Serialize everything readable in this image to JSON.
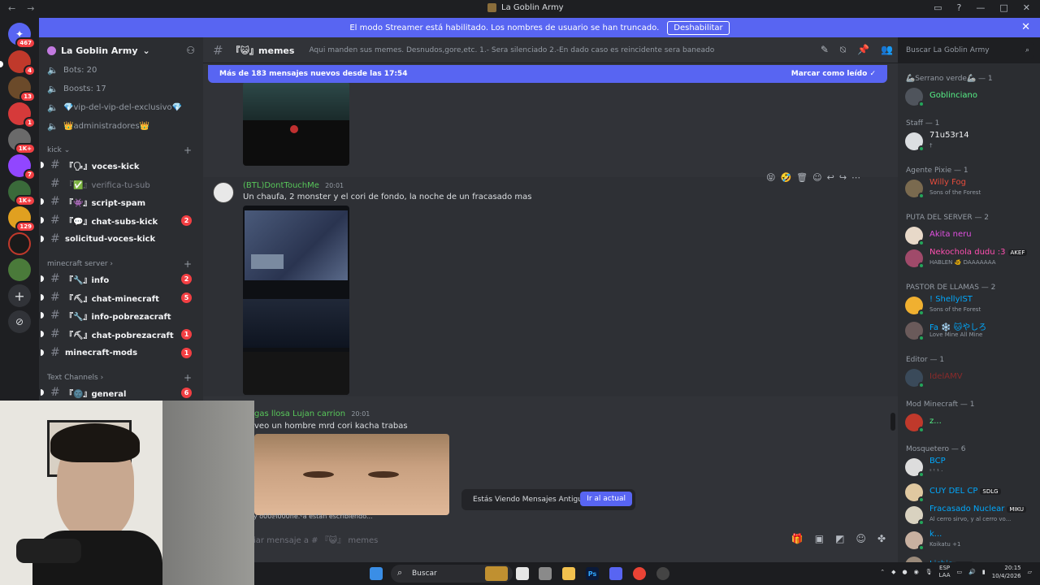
{
  "titlebar": {
    "title": "La Goblin Army"
  },
  "banner": {
    "text": "El modo Streamer está habilitado. Los nombres de usuario se han truncado.",
    "button": "Deshabilitar"
  },
  "guilds": {
    "badges": [
      "467",
      "4",
      "13",
      "1",
      "1K+",
      "7",
      "1K+",
      "129"
    ]
  },
  "server": {
    "name": "La Goblin Army"
  },
  "sidebar": {
    "top_items": [
      "Bots: 20",
      "Boosts: 17",
      "💎vip-del-vip-del-exclusivo💎",
      "👑administradores👑"
    ],
    "cat_kick": "kick",
    "kick_channels": [
      {
        "label": "『🗣』voces-kick",
        "badge": ""
      },
      {
        "label": "『✅』verifica-tu-sub",
        "badge": ""
      },
      {
        "label": "『👾』script-spam",
        "badge": ""
      },
      {
        "label": "『💬』chat-subs-kick",
        "badge": "2"
      },
      {
        "label": "solicitud-voces-kick",
        "badge": ""
      }
    ],
    "cat_mc": "minecraft server",
    "mc_channels": [
      {
        "label": "『🔧』info",
        "badge": "2"
      },
      {
        "label": "『⛏』chat-minecraft",
        "badge": "5"
      },
      {
        "label": "『🔧』info-pobrezacraft",
        "badge": ""
      },
      {
        "label": "『⛏』chat-pobrezacraft",
        "badge": "1"
      },
      {
        "label": "minecraft-mods",
        "badge": "1"
      }
    ],
    "cat_text": "Text Channels",
    "text_channels": [
      {
        "label": "『🌚』general",
        "badge": "6"
      }
    ]
  },
  "channel": {
    "name": "『😺』memes",
    "topic": "Aqui manden sus memes. Desnudos,gore,etc. 1.- Sera silenciado 2.-En dado caso es reincidente sera baneado"
  },
  "search": {
    "placeholder": "Buscar La Goblin Army"
  },
  "chat": {
    "new_messages": "Más de 183 mensajes nuevos desde las 17:54",
    "mark_read": "Marcar como leído",
    "messages": [
      {
        "author": "(BTL)DontTouchMe",
        "time": "20:01",
        "text": "Un chaufa, 2 monster y el cori de fondo, la noche de un fracasado mas"
      },
      {
        "author": "gas llosa Lujan carrion",
        "time": "20:01",
        "text": "veo un hombre mrd cori kacha trabas"
      }
    ],
    "old_notice": "Estás Viendo Mensajes Antiguos",
    "jump": "Ir al actual",
    "typing": "y o00ⅇl000ne.ᵉa  están escribiendo...",
    "composer_placeholder": "iar mensaje a # 『😺』 memes"
  },
  "members": {
    "roles": [
      {
        "title": "🦾Serrano verde🦾 — 1",
        "members": [
          {
            "name": "Goblinciano",
            "sub": "",
            "color": "#57f287",
            "avatar": "#4f545c"
          }
        ]
      },
      {
        "title": "Staff — 1",
        "members": [
          {
            "name": "71u53r14",
            "sub": "†",
            "color": "#f2f3f5",
            "avatar": "#dbdee1"
          }
        ]
      },
      {
        "title": "Agente Pixie — 1",
        "members": [
          {
            "name": "Willy Fog",
            "sub": "Sons of the Forest",
            "color": "#e74c3c",
            "avatar": "#7a6a4f"
          }
        ]
      },
      {
        "title": "PUTA DEL SERVER — 2",
        "members": [
          {
            "name": "Akita neru",
            "sub": "",
            "color": "#e050e0",
            "avatar": "#e8d9c9"
          },
          {
            "name": "Nekochola dudu :3",
            "sub": "HABLEN 🐠 DAAAAAAA",
            "color": "#ff4fb0",
            "avatar": "#a04a6a",
            "tag": "AKEF"
          }
        ]
      },
      {
        "title": "PASTOR DE LLAMAS — 2",
        "members": [
          {
            "name": "! ShellyIST",
            "sub": "Sons of the Forest",
            "color": "#00a8fc",
            "avatar": "#f0b030"
          },
          {
            "name": "Fa ❄️ 🐱やしろ",
            "sub": "Love Mine All Mine",
            "color": "#00a8fc",
            "avatar": "#6a5a5a"
          }
        ]
      },
      {
        "title": "Editor — 1",
        "members": [
          {
            "name": "IdelAMV",
            "sub": "",
            "color": "#8a2a2a",
            "avatar": "#3a4a5a"
          }
        ]
      },
      {
        "title": "Mod Minecraft — 1",
        "members": [
          {
            "name": "z...",
            "sub": "",
            "color": "#57f287",
            "avatar": "#c0392b"
          }
        ]
      },
      {
        "title": "Mosquetero — 6",
        "members": [
          {
            "name": "BCP",
            "sub": "ˢ ᵗ ¹ ·",
            "color": "#00a8fc",
            "avatar": "#ddd"
          },
          {
            "name": "CUY DEL CP",
            "sub": "",
            "color": "#00a8fc",
            "avatar": "#e0c8a0",
            "tag": "SDLG"
          },
          {
            "name": "Fracasado Nuclear",
            "sub": "Al cerro sirvo, y al cerro vo...",
            "color": "#00a8fc",
            "avatar": "#d9d2c0",
            "tag": "MIKU"
          },
          {
            "name": "k...",
            "sub": "Koikatu +1",
            "color": "#00a8fc",
            "avatar": "#c8b0a0"
          },
          {
            "name": "Lichis",
            "sub": "",
            "color": "#00a8fc",
            "avatar": "#9a8a7a",
            "tag": "RIOT"
          }
        ]
      }
    ]
  },
  "taskbar": {
    "search": "Buscar",
    "lang1": "ESP",
    "lang2": "LAA",
    "time": "20:15",
    "date": "10/4/2026"
  }
}
